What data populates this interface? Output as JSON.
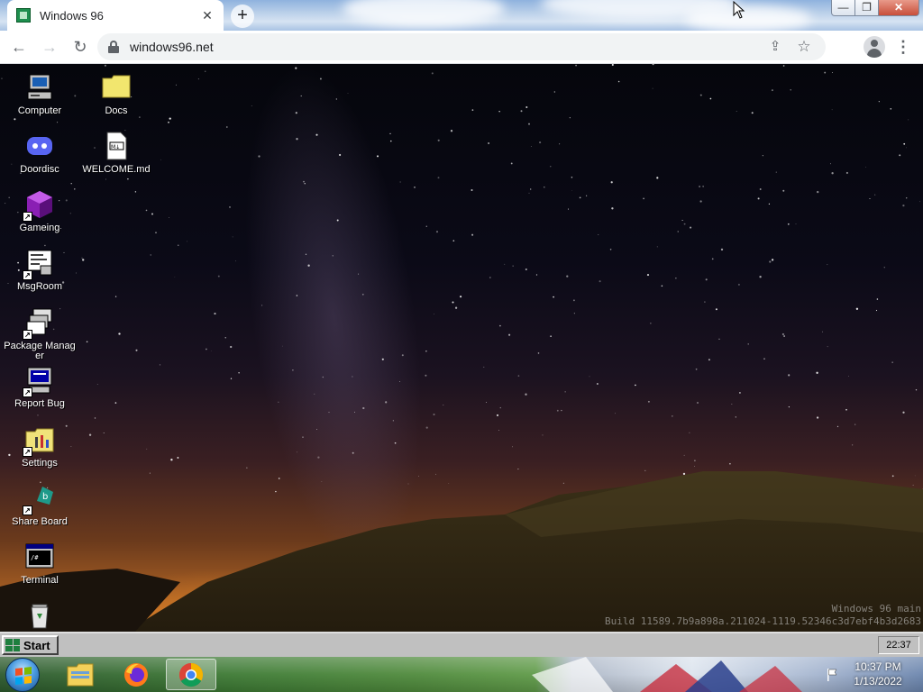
{
  "browser": {
    "tab_title": "Windows 96",
    "tab_close": "✕",
    "new_tab": "+",
    "url": "windows96.net",
    "nav": {
      "back": "←",
      "forward": "→",
      "reload": "↻"
    },
    "window_controls": {
      "minimize": "—",
      "maximize": "❐",
      "close": "✕"
    },
    "omni_icons": {
      "share": "⇪",
      "bookmark": "☆"
    },
    "menu": "⋮"
  },
  "desktop": {
    "icons": [
      {
        "label": "Computer",
        "icon": "computer-icon"
      },
      {
        "label": "Doordisc",
        "icon": "discord-icon"
      },
      {
        "label": "Gameing",
        "icon": "game-cube-icon"
      },
      {
        "label": "MsgRoom",
        "icon": "chat-icon"
      },
      {
        "label": "Package Manager",
        "icon": "package-icon"
      },
      {
        "label": "Report Bug",
        "icon": "monitor-bug-icon"
      },
      {
        "label": "Settings",
        "icon": "settings-folder-icon"
      },
      {
        "label": "Share Board",
        "icon": "share-board-icon"
      },
      {
        "label": "Terminal",
        "icon": "terminal-icon"
      },
      {
        "label": "",
        "icon": "recycle-bin-icon"
      },
      {
        "label": "Docs",
        "icon": "folder-icon"
      },
      {
        "label": "WELCOME.md",
        "icon": "markdown-file-icon"
      }
    ],
    "watermark_line1": "Windows 96 main",
    "watermark_line2": "Build 11589.7b9a898a.211024-1119.52346c3d7ebf4b3d2683"
  },
  "w96_taskbar": {
    "start_label": "Start",
    "clock": "22:37"
  },
  "win7_taskbar": {
    "apps": [
      "explorer-icon",
      "firefox-icon",
      "chrome-icon"
    ],
    "time": "10:37 PM",
    "date": "1/13/2022"
  },
  "colors": {
    "w96_gray": "#c0c0c0",
    "tab_bg": "#ffffff",
    "favicon_green": "#1e8f4e"
  }
}
